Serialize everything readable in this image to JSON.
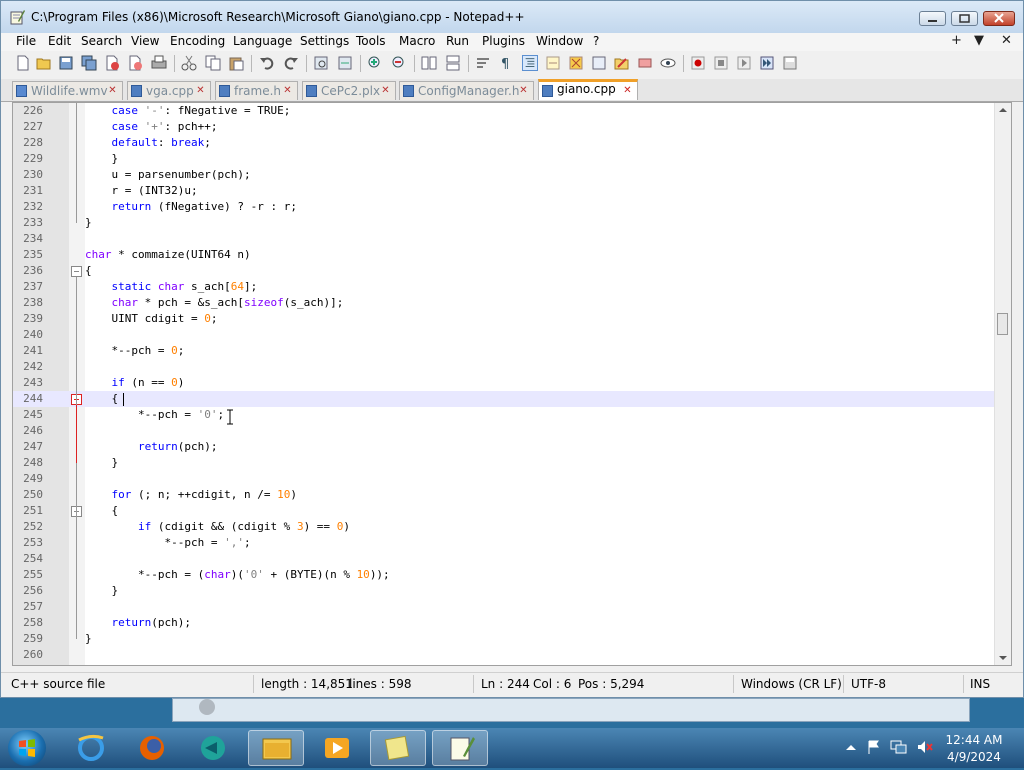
{
  "window": {
    "title": "C:\\Program Files (x86)\\Microsoft Research\\Microsoft Giano\\giano.cpp - Notepad++"
  },
  "menu": {
    "items": [
      "File",
      "Edit",
      "Search",
      "View",
      "Encoding",
      "Language",
      "Settings",
      "Tools",
      "Macro",
      "Run",
      "Plugins",
      "Window",
      "?"
    ],
    "right": [
      "+",
      "▼",
      "✕"
    ]
  },
  "tabs": [
    {
      "label": "Wildlife.wmv",
      "active": false
    },
    {
      "label": "vga.cpp",
      "active": false
    },
    {
      "label": "frame.h",
      "active": false
    },
    {
      "label": "CePc2.plx",
      "active": false
    },
    {
      "label": "ConfigManager.h",
      "active": false
    },
    {
      "label": "giano.cpp",
      "active": true
    }
  ],
  "editor": {
    "current_line": "244",
    "lines": [
      {
        "n": "226",
        "text": "    case '-': fNegative = TRUE;"
      },
      {
        "n": "227",
        "text": "    case '+': pch++;"
      },
      {
        "n": "228",
        "text": "    default: break;"
      },
      {
        "n": "229",
        "text": "    }"
      },
      {
        "n": "230",
        "text": "    u = parsenumber(pch);"
      },
      {
        "n": "231",
        "text": "    r = (INT32)u;"
      },
      {
        "n": "232",
        "text": "    return (fNegative) ? -r : r;"
      },
      {
        "n": "233",
        "text": "}"
      },
      {
        "n": "234",
        "text": ""
      },
      {
        "n": "235",
        "text": "char * commaize(UINT64 n)"
      },
      {
        "n": "236",
        "text": "{"
      },
      {
        "n": "237",
        "text": "    static char s_ach[64];"
      },
      {
        "n": "238",
        "text": "    char * pch = &s_ach[sizeof(s_ach)];"
      },
      {
        "n": "239",
        "text": "    UINT cdigit = 0;"
      },
      {
        "n": "240",
        "text": ""
      },
      {
        "n": "241",
        "text": "    *--pch = 0;"
      },
      {
        "n": "242",
        "text": ""
      },
      {
        "n": "243",
        "text": "    if (n == 0)"
      },
      {
        "n": "244",
        "text": "    {"
      },
      {
        "n": "245",
        "text": "        *--pch = '0';"
      },
      {
        "n": "246",
        "text": ""
      },
      {
        "n": "247",
        "text": "        return(pch);"
      },
      {
        "n": "248",
        "text": "    }"
      },
      {
        "n": "249",
        "text": ""
      },
      {
        "n": "250",
        "text": "    for (; n; ++cdigit, n /= 10)"
      },
      {
        "n": "251",
        "text": "    {"
      },
      {
        "n": "252",
        "text": "        if (cdigit && (cdigit % 3) == 0)"
      },
      {
        "n": "253",
        "text": "            *--pch = ',';"
      },
      {
        "n": "254",
        "text": ""
      },
      {
        "n": "255",
        "text": "        *--pch = (char)('0' + (BYTE)(n % 10));"
      },
      {
        "n": "256",
        "text": "    }"
      },
      {
        "n": "257",
        "text": ""
      },
      {
        "n": "258",
        "text": "    return(pch);"
      },
      {
        "n": "259",
        "text": "}"
      },
      {
        "n": "260",
        "text": ""
      }
    ]
  },
  "status": {
    "file_type": "C++ source file",
    "length": "length : 14,851",
    "lines": "lines : 598",
    "ln": "Ln : 244",
    "col": "Col : 6",
    "pos": "Pos : 5,294",
    "eol": "Windows (CR LF)",
    "encoding": "UTF-8",
    "mode": "INS"
  },
  "taskbar": {
    "time": "12:44 AM",
    "date": "4/9/2024"
  },
  "colors": {
    "keyword": "#0000ff",
    "type": "#8000ff",
    "number": "#ff8000",
    "current_line_bg": "#e8e8ff",
    "active_tab_accent": "#f0a028"
  }
}
